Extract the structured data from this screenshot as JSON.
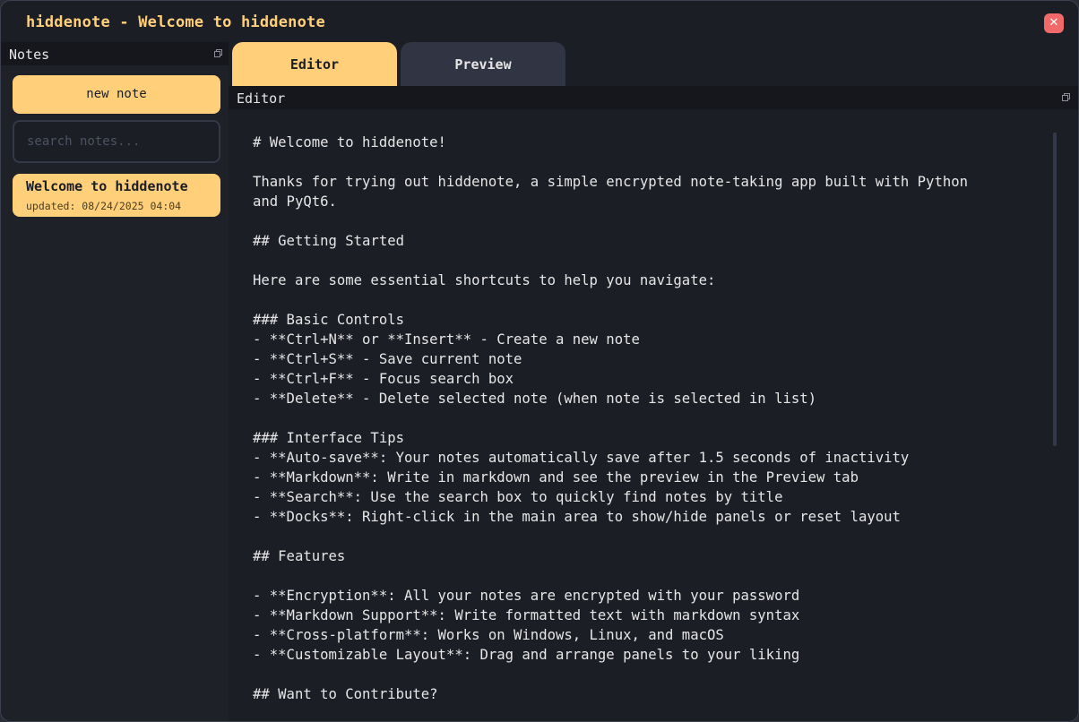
{
  "window": {
    "title": "hiddenote - Welcome to hiddenote",
    "close_glyph": "✕"
  },
  "notes_panel": {
    "title": "Notes",
    "float_icon": "float-window-icon",
    "new_note_label": "new note",
    "search_placeholder": "search notes...",
    "items": [
      {
        "title": "Welcome to hiddenote",
        "updated": "updated: 08/24/2025 04:04"
      }
    ]
  },
  "tabs": [
    {
      "label": "Editor",
      "active": true
    },
    {
      "label": "Preview",
      "active": false
    }
  ],
  "editor_panel": {
    "title": "Editor",
    "float_icon": "float-window-icon",
    "content": "# Welcome to hiddenote!\n\nThanks for trying out hiddenote, a simple encrypted note-taking app built with Python\nand PyQt6.\n\n## Getting Started\n\nHere are some essential shortcuts to help you navigate:\n\n### Basic Controls\n- **Ctrl+N** or **Insert** - Create a new note\n- **Ctrl+S** - Save current note\n- **Ctrl+F** - Focus search box\n- **Delete** - Delete selected note (when note is selected in list)\n\n### Interface Tips\n- **Auto-save**: Your notes automatically save after 1.5 seconds of inactivity\n- **Markdown**: Write in markdown and see the preview in the Preview tab\n- **Search**: Use the search box to quickly find notes by title\n- **Docks**: Right-click in the main area to show/hide panels or reset layout\n\n## Features\n\n- **Encryption**: All your notes are encrypted with your password\n- **Markdown Support**: Write formatted text with markdown syntax\n- **Cross-platform**: Works on Windows, Linux, and macOS\n- **Customizable Layout**: Drag and arrange panels to your liking\n\n## Want to Contribute?"
  },
  "colors": {
    "accent": "#ffcf7a",
    "background": "#1c1e25",
    "panel": "#1f2129",
    "header": "#15171c",
    "inactive_tab": "#313442",
    "close": "#f06a6a",
    "text": "#e6e6e6"
  }
}
